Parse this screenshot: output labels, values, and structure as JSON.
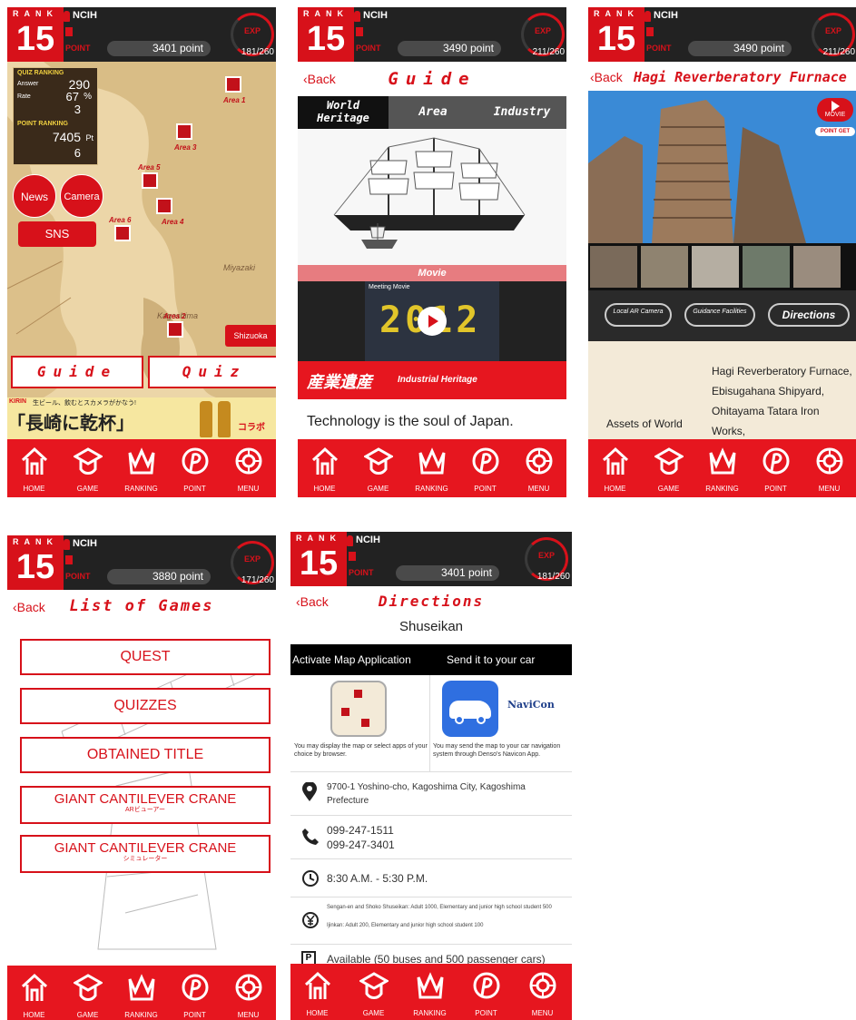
{
  "rank_label": "RANK",
  "rank": "15",
  "user_name": "NCIH",
  "point_label": "POINT",
  "exp_label": "EXP",
  "nav": [
    "HOME",
    "GAME",
    "RANKING",
    "POINT",
    "MENU"
  ],
  "back_label": "Back",
  "screens": {
    "home": {
      "points": "3401 point",
      "exp": "181/260",
      "quiz_ranking_title": "QUIZ RANKING",
      "answer_label": "Answer",
      "answer_value": "290",
      "rate_label": "Rate",
      "rate_value": "67",
      "rate_unit": "%",
      "quiz_rank": "3",
      "point_ranking_title": "POINT RANKING",
      "point_total": "7405",
      "point_unit": "Pt",
      "point_rank": "6",
      "area_labels": [
        "Area 1",
        "Area 3",
        "Area 4",
        "Area 5",
        "Area 6",
        "Area 7",
        "Area 2"
      ],
      "map_places": [
        "Miyazaki",
        "Kagoshima"
      ],
      "news": "News",
      "camera": "Camera",
      "sns": "SNS",
      "shizuoka": "Shizuoka",
      "guide": "Guide",
      "quiz": "Quiz",
      "ad_brand": "KIRIN",
      "ad_top": "生ビール、飲むとスカメラがかなう!",
      "ad_main": "「長崎に乾杯」",
      "ad_side": "コラボ"
    },
    "guide": {
      "points": "3490 point",
      "exp": "211/260",
      "title": "Guide",
      "tabs": [
        "World Heritage",
        "Area",
        "Industry"
      ],
      "movie_label": "Movie",
      "movie_sub": "Meeting Movie",
      "video_year": "2012",
      "heritage_jp": "産業遺産",
      "heritage_en": "Industrial Heritage",
      "tagline": "Technology is the soul of Japan."
    },
    "furnace": {
      "points": "3490 point",
      "exp": "211/260",
      "title": "Hagi Reverberatory Furnace",
      "movie_btn": "MOVIE",
      "point_get": "POINT GET",
      "buttons": [
        "Local AR Camera",
        "Guidance Facilities",
        "Directions"
      ],
      "desc_left": "Assets of World",
      "desc_right": "Hagi Reverberatory Furnace, Ebisugahana Shipyard, Ohitayama Tatara Iron Works,"
    },
    "games": {
      "points": "3880 point",
      "exp": "171/260",
      "title": "List of Games",
      "items": [
        "QUEST",
        "QUIZZES",
        "OBTAINED TITLE",
        "GIANT CANTILEVER CRANE",
        "GIANT CANTILEVER CRANE"
      ],
      "subs": [
        "",
        "",
        "",
        "ARビューアー",
        "シミュレーター"
      ]
    },
    "directions": {
      "points": "3401 point",
      "exp": "181/260",
      "title": "Directions",
      "place": "Shuseikan",
      "activate": "Activate Map Application",
      "send": "Send it to your car",
      "navicon": "NaviCon",
      "map_desc": "You may display the map or select apps of your choice by browser.",
      "car_desc": "You may send the map to your car navigation system through Denso's Navicon App.",
      "address": "9700-1 Yoshino-cho, Kagoshima City, Kagoshima Prefecture",
      "phone1": "099-247-1511",
      "phone2": "099-247-3401",
      "hours": "8:30 A.M. - 5:30 P.M.",
      "fee1": "Sengan-en and Shoko Shuseikan: Adult 1000, Elementary and junior high school student 500",
      "fee2": "Ijinkan: Adult 200, Elementary and junior high school student 100",
      "parking": "Available (50 buses and 500 passenger cars)"
    }
  }
}
